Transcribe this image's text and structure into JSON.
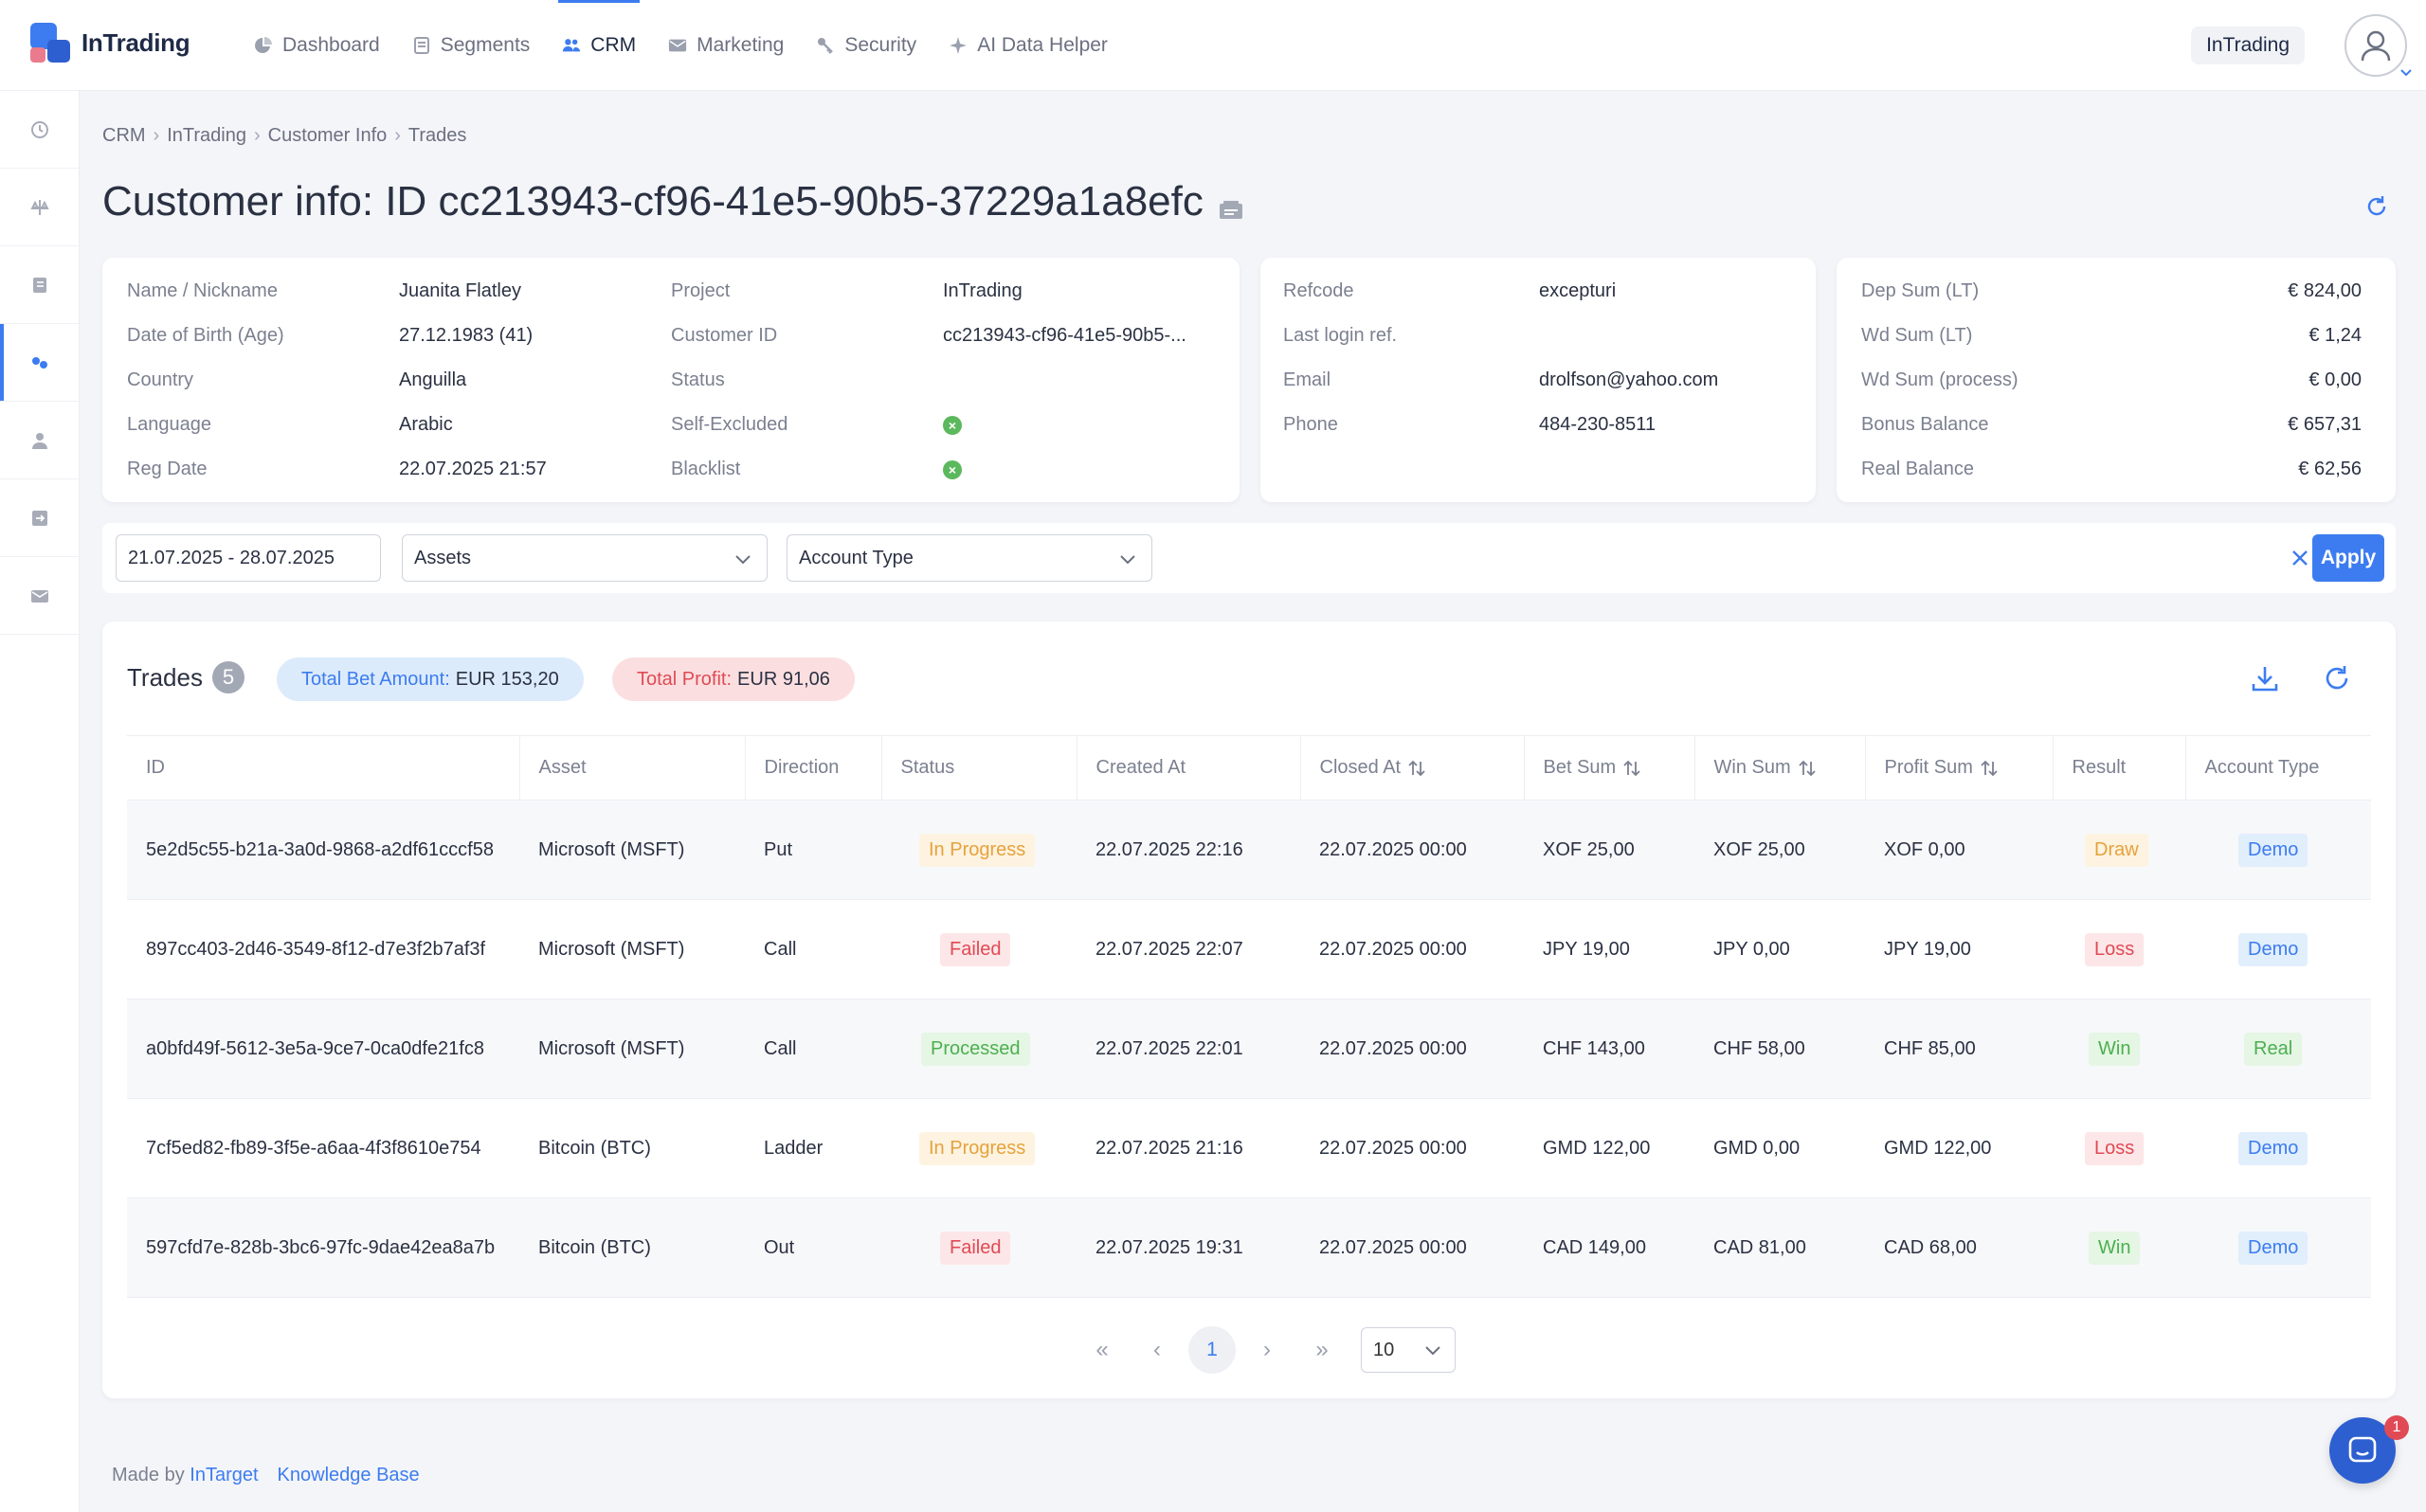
{
  "app": {
    "name": "InTrading"
  },
  "nav": [
    {
      "label": "Dashboard",
      "icon": "pie-chart-icon"
    },
    {
      "label": "Segments",
      "icon": "document-icon"
    },
    {
      "label": "CRM",
      "icon": "users-icon",
      "active": true
    },
    {
      "label": "Marketing",
      "icon": "mail-icon"
    },
    {
      "label": "Security",
      "icon": "key-icon"
    },
    {
      "label": "AI Data Helper",
      "icon": "sparkle-icon"
    }
  ],
  "header": {
    "tenant": "InTrading"
  },
  "breadcrumb": [
    "CRM",
    "InTrading",
    "Customer Info",
    "Trades"
  ],
  "page_title": "Customer info: ID cc213943-cf96-41e5-90b5-37229a1a8efc",
  "customer": {
    "col1": [
      {
        "label": "Name / Nickname",
        "value": "Juanita Flatley"
      },
      {
        "label": "Date of Birth (Age)",
        "value": "27.12.1983 (41)"
      },
      {
        "label": "Country",
        "value": "Anguilla"
      },
      {
        "label": "Language",
        "value": "Arabic"
      },
      {
        "label": "Reg Date",
        "value": "22.07.2025 21:57"
      }
    ],
    "col2": [
      {
        "label": "Project",
        "value": "InTrading"
      },
      {
        "label": "Customer ID",
        "value": "cc213943-cf96-41e5-90b5-..."
      },
      {
        "label": "Status",
        "value": ""
      },
      {
        "label": "Self-Excluded",
        "value": ""
      },
      {
        "label": "Blacklist",
        "value": ""
      }
    ],
    "contact": [
      {
        "label": "Refcode",
        "value": "excepturi"
      },
      {
        "label": "Last login ref.",
        "value": ""
      },
      {
        "label": "Email",
        "value": "drolfson@yahoo.com"
      },
      {
        "label": "Phone",
        "value": "484-230-8511"
      }
    ],
    "balances": [
      {
        "label": "Dep Sum (LT)",
        "value": "€ 824,00"
      },
      {
        "label": "Wd Sum (LT)",
        "value": "€ 1,24"
      },
      {
        "label": "Wd Sum (process)",
        "value": "€ 0,00"
      },
      {
        "label": "Bonus Balance",
        "value": "€ 657,31"
      },
      {
        "label": "Real Balance",
        "value": "€ 62,56"
      }
    ]
  },
  "filters": {
    "date_range": "21.07.2025 - 28.07.2025",
    "assets_placeholder": "Assets",
    "account_type_placeholder": "Account Type",
    "apply_label": "Apply"
  },
  "trades": {
    "title": "Trades",
    "count": "5",
    "total_bet_label": "Total Bet Amount:",
    "total_bet_value": "EUR 153,20",
    "total_profit_label": "Total Profit:",
    "total_profit_value": "EUR 91,06",
    "columns": [
      "ID",
      "Asset",
      "Direction",
      "Status",
      "Created At",
      "Closed At",
      "Bet Sum",
      "Win Sum",
      "Profit Sum",
      "Result",
      "Account Type"
    ],
    "rows": [
      {
        "id": "5e2d5c55-b21a-3a0d-9868-a2df61cccf58",
        "asset": "Microsoft (MSFT)",
        "direction": "Put",
        "status": "In Progress",
        "created": "22.07.2025 22:16",
        "closed": "22.07.2025 00:00",
        "bet": "XOF 25,00",
        "win": "XOF 25,00",
        "profit": "XOF 0,00",
        "result": "Draw",
        "account": "Demo"
      },
      {
        "id": "897cc403-2d46-3549-8f12-d7e3f2b7af3f",
        "asset": "Microsoft (MSFT)",
        "direction": "Call",
        "status": "Failed",
        "created": "22.07.2025 22:07",
        "closed": "22.07.2025 00:00",
        "bet": "JPY 19,00",
        "win": "JPY 0,00",
        "profit": "JPY 19,00",
        "result": "Loss",
        "account": "Demo"
      },
      {
        "id": "a0bfd49f-5612-3e5a-9ce7-0ca0dfe21fc8",
        "asset": "Microsoft (MSFT)",
        "direction": "Call",
        "status": "Processed",
        "created": "22.07.2025 22:01",
        "closed": "22.07.2025 00:00",
        "bet": "CHF 143,00",
        "win": "CHF 58,00",
        "profit": "CHF 85,00",
        "result": "Win",
        "account": "Real"
      },
      {
        "id": "7cf5ed82-fb89-3f5e-a6aa-4f3f8610e754",
        "asset": "Bitcoin (BTC)",
        "direction": "Ladder",
        "status": "In Progress",
        "created": "22.07.2025 21:16",
        "closed": "22.07.2025 00:00",
        "bet": "GMD 122,00",
        "win": "GMD 0,00",
        "profit": "GMD 122,00",
        "result": "Loss",
        "account": "Demo"
      },
      {
        "id": "597cfd7e-828b-3bc6-97fc-9dae42ea8a7b",
        "asset": "Bitcoin (BTC)",
        "direction": "Out",
        "status": "Failed",
        "created": "22.07.2025 19:31",
        "closed": "22.07.2025 00:00",
        "bet": "CAD 149,00",
        "win": "CAD 81,00",
        "profit": "CAD 68,00",
        "result": "Win",
        "account": "Demo"
      }
    ]
  },
  "pagination": {
    "current_page": "1",
    "page_size": "10"
  },
  "footer": {
    "made_by": "Made by",
    "company": "InTarget",
    "kb": "Knowledge Base"
  },
  "chat": {
    "unread": "1"
  },
  "colors": {
    "accent": "#3c7cf0",
    "success": "#4caf50",
    "warning": "#e6a23c",
    "danger": "#e04a55"
  }
}
